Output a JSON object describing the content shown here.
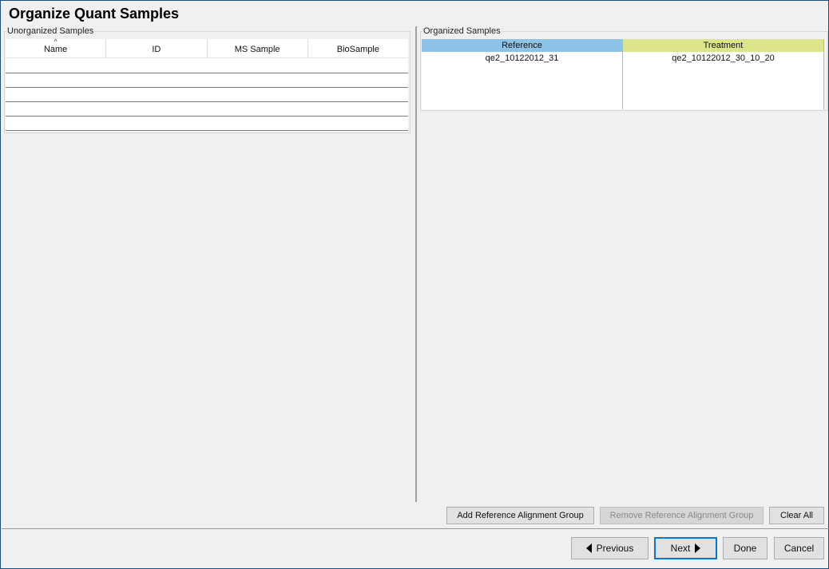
{
  "window": {
    "title": "Organize Quant Samples"
  },
  "unorganized": {
    "label": "Unorganized Samples",
    "columns": [
      "Name",
      "ID",
      "MS Sample",
      "BioSample"
    ],
    "sort_icon": "sort-ascending-icon"
  },
  "organized": {
    "label": "Organized Samples",
    "reference_header": "Reference",
    "treatment_header": "Treatment",
    "reference_value": "qe2_10122012_31",
    "treatment_value": "qe2_10122012_30_10_20",
    "colors": {
      "reference": "#8dc3e6",
      "treatment": "#dde58a"
    }
  },
  "actions": {
    "add_label": "Add Reference Alignment Group",
    "remove_label": "Remove Reference Alignment Group",
    "clear_label": "Clear All"
  },
  "footer": {
    "previous_label": "Previous",
    "next_label": "Next",
    "done_label": "Done",
    "cancel_label": "Cancel"
  }
}
